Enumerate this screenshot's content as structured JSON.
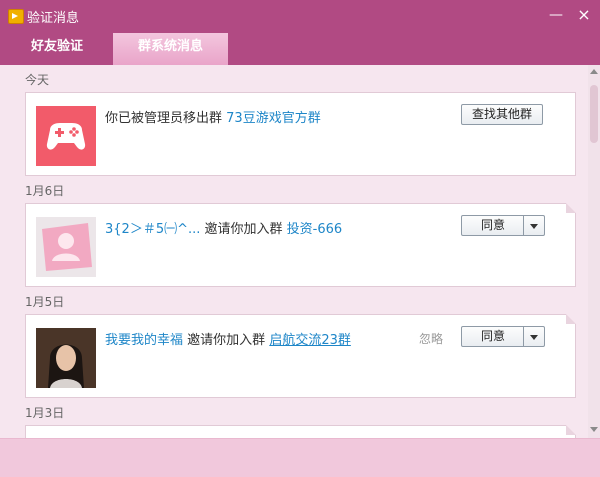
{
  "window": {
    "title": "验证消息",
    "minimize_symbol": "—",
    "close_symbol": "×",
    "icon": "speaker-icon"
  },
  "tabs": [
    {
      "label": "好友验证",
      "active": false
    },
    {
      "label": "群系统消息",
      "active": true
    }
  ],
  "dates": {
    "d0": "今天",
    "d1": "1月6日",
    "d2": "1月5日",
    "d3": "1月3日"
  },
  "messages": [
    {
      "avatar_icon": "gamepad-icon",
      "prefix": "你已被管理员移出群",
      "group": "73豆游戏官方群",
      "button": "查找其他群"
    },
    {
      "avatar_icon": "default-avatar-icon",
      "user": "3{2＞＃5㈠^...",
      "action": "邀请你加入群",
      "group": "投资-666",
      "button": "同意"
    },
    {
      "avatar_icon": "user-photo",
      "user": "我要我的幸福",
      "action": "邀请你加入群",
      "group": "启航交流23群",
      "ignore": "忽略",
      "button": "同意"
    }
  ],
  "colors": {
    "theme": "#b14a83",
    "tab_active": "#f3c6de",
    "link": "#1e86c8",
    "content_bg": "#f6e6ef"
  }
}
